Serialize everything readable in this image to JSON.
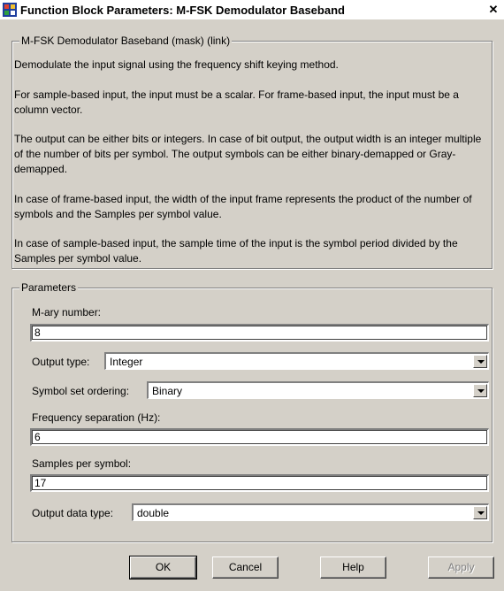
{
  "window": {
    "title": "Function Block Parameters: M-FSK Demodulator Baseband",
    "close_glyph": "✕"
  },
  "mask": {
    "legend": "M-FSK Demodulator Baseband (mask) (link)",
    "paragraphs": [
      "Demodulate the input signal using the frequency shift keying method.",
      "For sample-based input, the input must be a scalar. For frame-based input, the input must be a column vector.",
      "The output can be either bits or integers. In case of bit output, the output width is an integer multiple of the number of bits per symbol. The output symbols can be either binary-demapped or Gray-demapped.",
      "In case of frame-based input, the width of the input frame represents the product of the number of symbols and the Samples per symbol value.",
      "In case of sample-based input, the sample time of the input is the symbol period divided by the Samples per symbol value."
    ]
  },
  "params": {
    "legend": "Parameters",
    "mary_label": "M-ary number:",
    "mary_value": "8",
    "output_type_label": "Output type:",
    "output_type_value": "Integer",
    "ordering_label": "Symbol set ordering:",
    "ordering_value": "Binary",
    "freq_sep_label": "Frequency separation (Hz):",
    "freq_sep_value": "6",
    "samples_label": "Samples per symbol:",
    "samples_value": "17",
    "data_type_label": "Output data type:",
    "data_type_value": "double"
  },
  "buttons": {
    "ok": "OK",
    "cancel": "Cancel",
    "help": "Help",
    "apply": "Apply"
  }
}
